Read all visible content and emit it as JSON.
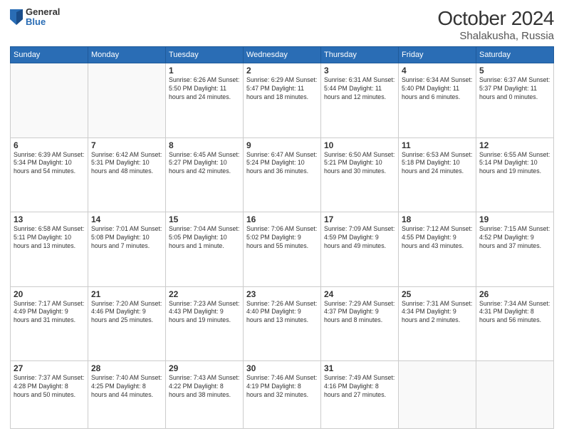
{
  "logo": {
    "general": "General",
    "blue": "Blue"
  },
  "title": {
    "month": "October 2024",
    "location": "Shalakusha, Russia"
  },
  "days_header": [
    "Sunday",
    "Monday",
    "Tuesday",
    "Wednesday",
    "Thursday",
    "Friday",
    "Saturday"
  ],
  "weeks": [
    [
      {
        "num": "",
        "detail": ""
      },
      {
        "num": "",
        "detail": ""
      },
      {
        "num": "1",
        "detail": "Sunrise: 6:26 AM\nSunset: 5:50 PM\nDaylight: 11 hours\nand 24 minutes."
      },
      {
        "num": "2",
        "detail": "Sunrise: 6:29 AM\nSunset: 5:47 PM\nDaylight: 11 hours\nand 18 minutes."
      },
      {
        "num": "3",
        "detail": "Sunrise: 6:31 AM\nSunset: 5:44 PM\nDaylight: 11 hours\nand 12 minutes."
      },
      {
        "num": "4",
        "detail": "Sunrise: 6:34 AM\nSunset: 5:40 PM\nDaylight: 11 hours\nand 6 minutes."
      },
      {
        "num": "5",
        "detail": "Sunrise: 6:37 AM\nSunset: 5:37 PM\nDaylight: 11 hours\nand 0 minutes."
      }
    ],
    [
      {
        "num": "6",
        "detail": "Sunrise: 6:39 AM\nSunset: 5:34 PM\nDaylight: 10 hours\nand 54 minutes."
      },
      {
        "num": "7",
        "detail": "Sunrise: 6:42 AM\nSunset: 5:31 PM\nDaylight: 10 hours\nand 48 minutes."
      },
      {
        "num": "8",
        "detail": "Sunrise: 6:45 AM\nSunset: 5:27 PM\nDaylight: 10 hours\nand 42 minutes."
      },
      {
        "num": "9",
        "detail": "Sunrise: 6:47 AM\nSunset: 5:24 PM\nDaylight: 10 hours\nand 36 minutes."
      },
      {
        "num": "10",
        "detail": "Sunrise: 6:50 AM\nSunset: 5:21 PM\nDaylight: 10 hours\nand 30 minutes."
      },
      {
        "num": "11",
        "detail": "Sunrise: 6:53 AM\nSunset: 5:18 PM\nDaylight: 10 hours\nand 24 minutes."
      },
      {
        "num": "12",
        "detail": "Sunrise: 6:55 AM\nSunset: 5:14 PM\nDaylight: 10 hours\nand 19 minutes."
      }
    ],
    [
      {
        "num": "13",
        "detail": "Sunrise: 6:58 AM\nSunset: 5:11 PM\nDaylight: 10 hours\nand 13 minutes."
      },
      {
        "num": "14",
        "detail": "Sunrise: 7:01 AM\nSunset: 5:08 PM\nDaylight: 10 hours\nand 7 minutes."
      },
      {
        "num": "15",
        "detail": "Sunrise: 7:04 AM\nSunset: 5:05 PM\nDaylight: 10 hours\nand 1 minute."
      },
      {
        "num": "16",
        "detail": "Sunrise: 7:06 AM\nSunset: 5:02 PM\nDaylight: 9 hours\nand 55 minutes."
      },
      {
        "num": "17",
        "detail": "Sunrise: 7:09 AM\nSunset: 4:59 PM\nDaylight: 9 hours\nand 49 minutes."
      },
      {
        "num": "18",
        "detail": "Sunrise: 7:12 AM\nSunset: 4:55 PM\nDaylight: 9 hours\nand 43 minutes."
      },
      {
        "num": "19",
        "detail": "Sunrise: 7:15 AM\nSunset: 4:52 PM\nDaylight: 9 hours\nand 37 minutes."
      }
    ],
    [
      {
        "num": "20",
        "detail": "Sunrise: 7:17 AM\nSunset: 4:49 PM\nDaylight: 9 hours\nand 31 minutes."
      },
      {
        "num": "21",
        "detail": "Sunrise: 7:20 AM\nSunset: 4:46 PM\nDaylight: 9 hours\nand 25 minutes."
      },
      {
        "num": "22",
        "detail": "Sunrise: 7:23 AM\nSunset: 4:43 PM\nDaylight: 9 hours\nand 19 minutes."
      },
      {
        "num": "23",
        "detail": "Sunrise: 7:26 AM\nSunset: 4:40 PM\nDaylight: 9 hours\nand 13 minutes."
      },
      {
        "num": "24",
        "detail": "Sunrise: 7:29 AM\nSunset: 4:37 PM\nDaylight: 9 hours\nand 8 minutes."
      },
      {
        "num": "25",
        "detail": "Sunrise: 7:31 AM\nSunset: 4:34 PM\nDaylight: 9 hours\nand 2 minutes."
      },
      {
        "num": "26",
        "detail": "Sunrise: 7:34 AM\nSunset: 4:31 PM\nDaylight: 8 hours\nand 56 minutes."
      }
    ],
    [
      {
        "num": "27",
        "detail": "Sunrise: 7:37 AM\nSunset: 4:28 PM\nDaylight: 8 hours\nand 50 minutes."
      },
      {
        "num": "28",
        "detail": "Sunrise: 7:40 AM\nSunset: 4:25 PM\nDaylight: 8 hours\nand 44 minutes."
      },
      {
        "num": "29",
        "detail": "Sunrise: 7:43 AM\nSunset: 4:22 PM\nDaylight: 8 hours\nand 38 minutes."
      },
      {
        "num": "30",
        "detail": "Sunrise: 7:46 AM\nSunset: 4:19 PM\nDaylight: 8 hours\nand 32 minutes."
      },
      {
        "num": "31",
        "detail": "Sunrise: 7:49 AM\nSunset: 4:16 PM\nDaylight: 8 hours\nand 27 minutes."
      },
      {
        "num": "",
        "detail": ""
      },
      {
        "num": "",
        "detail": ""
      }
    ]
  ]
}
